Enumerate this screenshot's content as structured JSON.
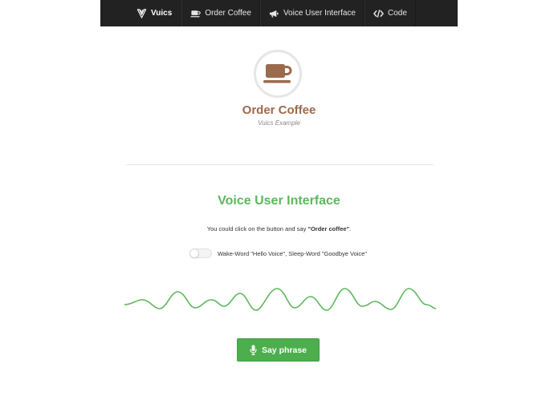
{
  "navbar": {
    "brand": "Vuics",
    "items": [
      {
        "label": "Order Coffee",
        "icon": "coffee-icon"
      },
      {
        "label": "Voice User Interface",
        "icon": "bullhorn-icon"
      },
      {
        "label": "Code",
        "icon": "code-icon"
      }
    ]
  },
  "header": {
    "title": "Order Coffee",
    "subtitle": "Vuics Example",
    "logo_icon": "coffee-cup-icon"
  },
  "voice": {
    "title": "Voice User Interface",
    "instruction_prefix": "You could click on the button and say ",
    "instruction_phrase": "\"Order coffee\"",
    "instruction_suffix": ".",
    "wake_label": "Wake-Word \"Hello Voice\", Sleep-Word \"Goodbye Voice\"",
    "wake_enabled": false,
    "button_label": "Say phrase",
    "button_icon": "microphone-icon"
  },
  "colors": {
    "navbar_bg": "#222222",
    "brand_brown": "#9b6a4d",
    "accent_green": "#5cb85c",
    "button_green": "#4cae4c"
  }
}
